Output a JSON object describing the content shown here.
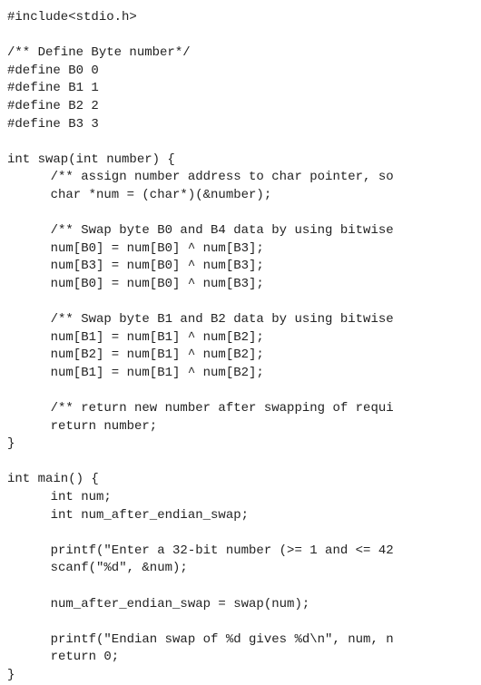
{
  "code": {
    "l1": "#include<stdio.h>",
    "l2": "",
    "l3": "/** Define Byte number*/",
    "l4": "#define B0 0",
    "l5": "#define B1 1",
    "l6": "#define B2 2",
    "l7": "#define B3 3",
    "l8": "",
    "l9": "int swap(int number) {",
    "l10": "/** assign number address to char pointer, so",
    "l11": "char *num = (char*)(&number);",
    "l12": "",
    "l13": "/** Swap byte B0 and B4 data by using bitwise",
    "l14": "num[B0] = num[B0] ^ num[B3];",
    "l15": "num[B3] = num[B0] ^ num[B3];",
    "l16": "num[B0] = num[B0] ^ num[B3];",
    "l17": "",
    "l18": "/** Swap byte B1 and B2 data by using bitwise",
    "l19": "num[B1] = num[B1] ^ num[B2];",
    "l20": "num[B2] = num[B1] ^ num[B2];",
    "l21": "num[B1] = num[B1] ^ num[B2];",
    "l22": "",
    "l23": "/** return new number after swapping of requi",
    "l24": "return number;",
    "l25": "}",
    "l26": "",
    "l27": "int main() {",
    "l28": "int num;",
    "l29": "int num_after_endian_swap;",
    "l30": "",
    "l31": "printf(\"Enter a 32-bit number (>= 1 and <= 42",
    "l32": "scanf(\"%d\", &num);",
    "l33": "",
    "l34": "num_after_endian_swap = swap(num);",
    "l35": "",
    "l36": "printf(\"Endian swap of %d gives %d\\n\", num, n",
    "l37": "return 0;",
    "l38": "}"
  }
}
